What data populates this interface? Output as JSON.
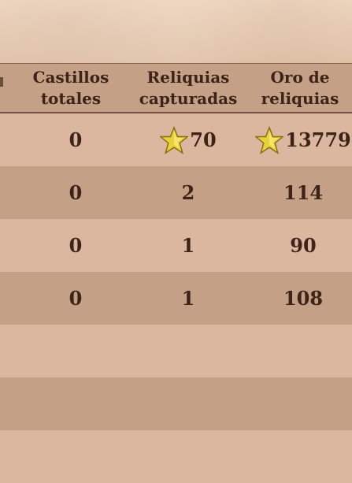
{
  "headers": {
    "total_castles": [
      "Castillos",
      "totales"
    ],
    "captured_relics": [
      "Reliquias",
      "capturadas"
    ],
    "relic_gold": [
      "Oro de",
      "reliquias"
    ]
  },
  "rows": [
    {
      "castles": "0",
      "relics": "70",
      "gold": "13779",
      "relics_star": true,
      "gold_star": true
    },
    {
      "castles": "0",
      "relics": "2",
      "gold": "114"
    },
    {
      "castles": "0",
      "relics": "1",
      "gold": "90"
    },
    {
      "castles": "0",
      "relics": "1",
      "gold": "108"
    },
    {
      "castles": "",
      "relics": "",
      "gold": ""
    },
    {
      "castles": "",
      "relics": "",
      "gold": ""
    }
  ],
  "colors": {
    "header_bg": "#c4a086",
    "row_light": "#dbb7a0",
    "row_dark": "#c4a086",
    "text": "#3e2418",
    "star": "#e8d23a"
  },
  "icons": {
    "top_value_marker": "star-icon"
  }
}
